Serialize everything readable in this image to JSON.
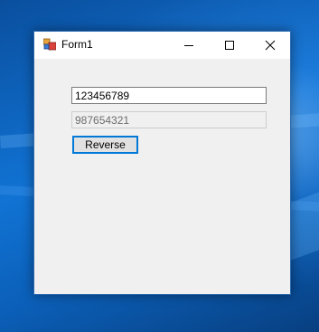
{
  "window": {
    "title": "Form1",
    "icon": "winforms-app-icon",
    "controls": [
      "minimize-icon",
      "maximize-icon",
      "close-icon"
    ]
  },
  "form": {
    "input_value": "123456789",
    "output_value": "987654321",
    "reverse_label": "Reverse"
  },
  "colors": {
    "accent": "#0078d7",
    "window_bg": "#f0f0f0",
    "titlebar_bg": "#ffffff"
  }
}
